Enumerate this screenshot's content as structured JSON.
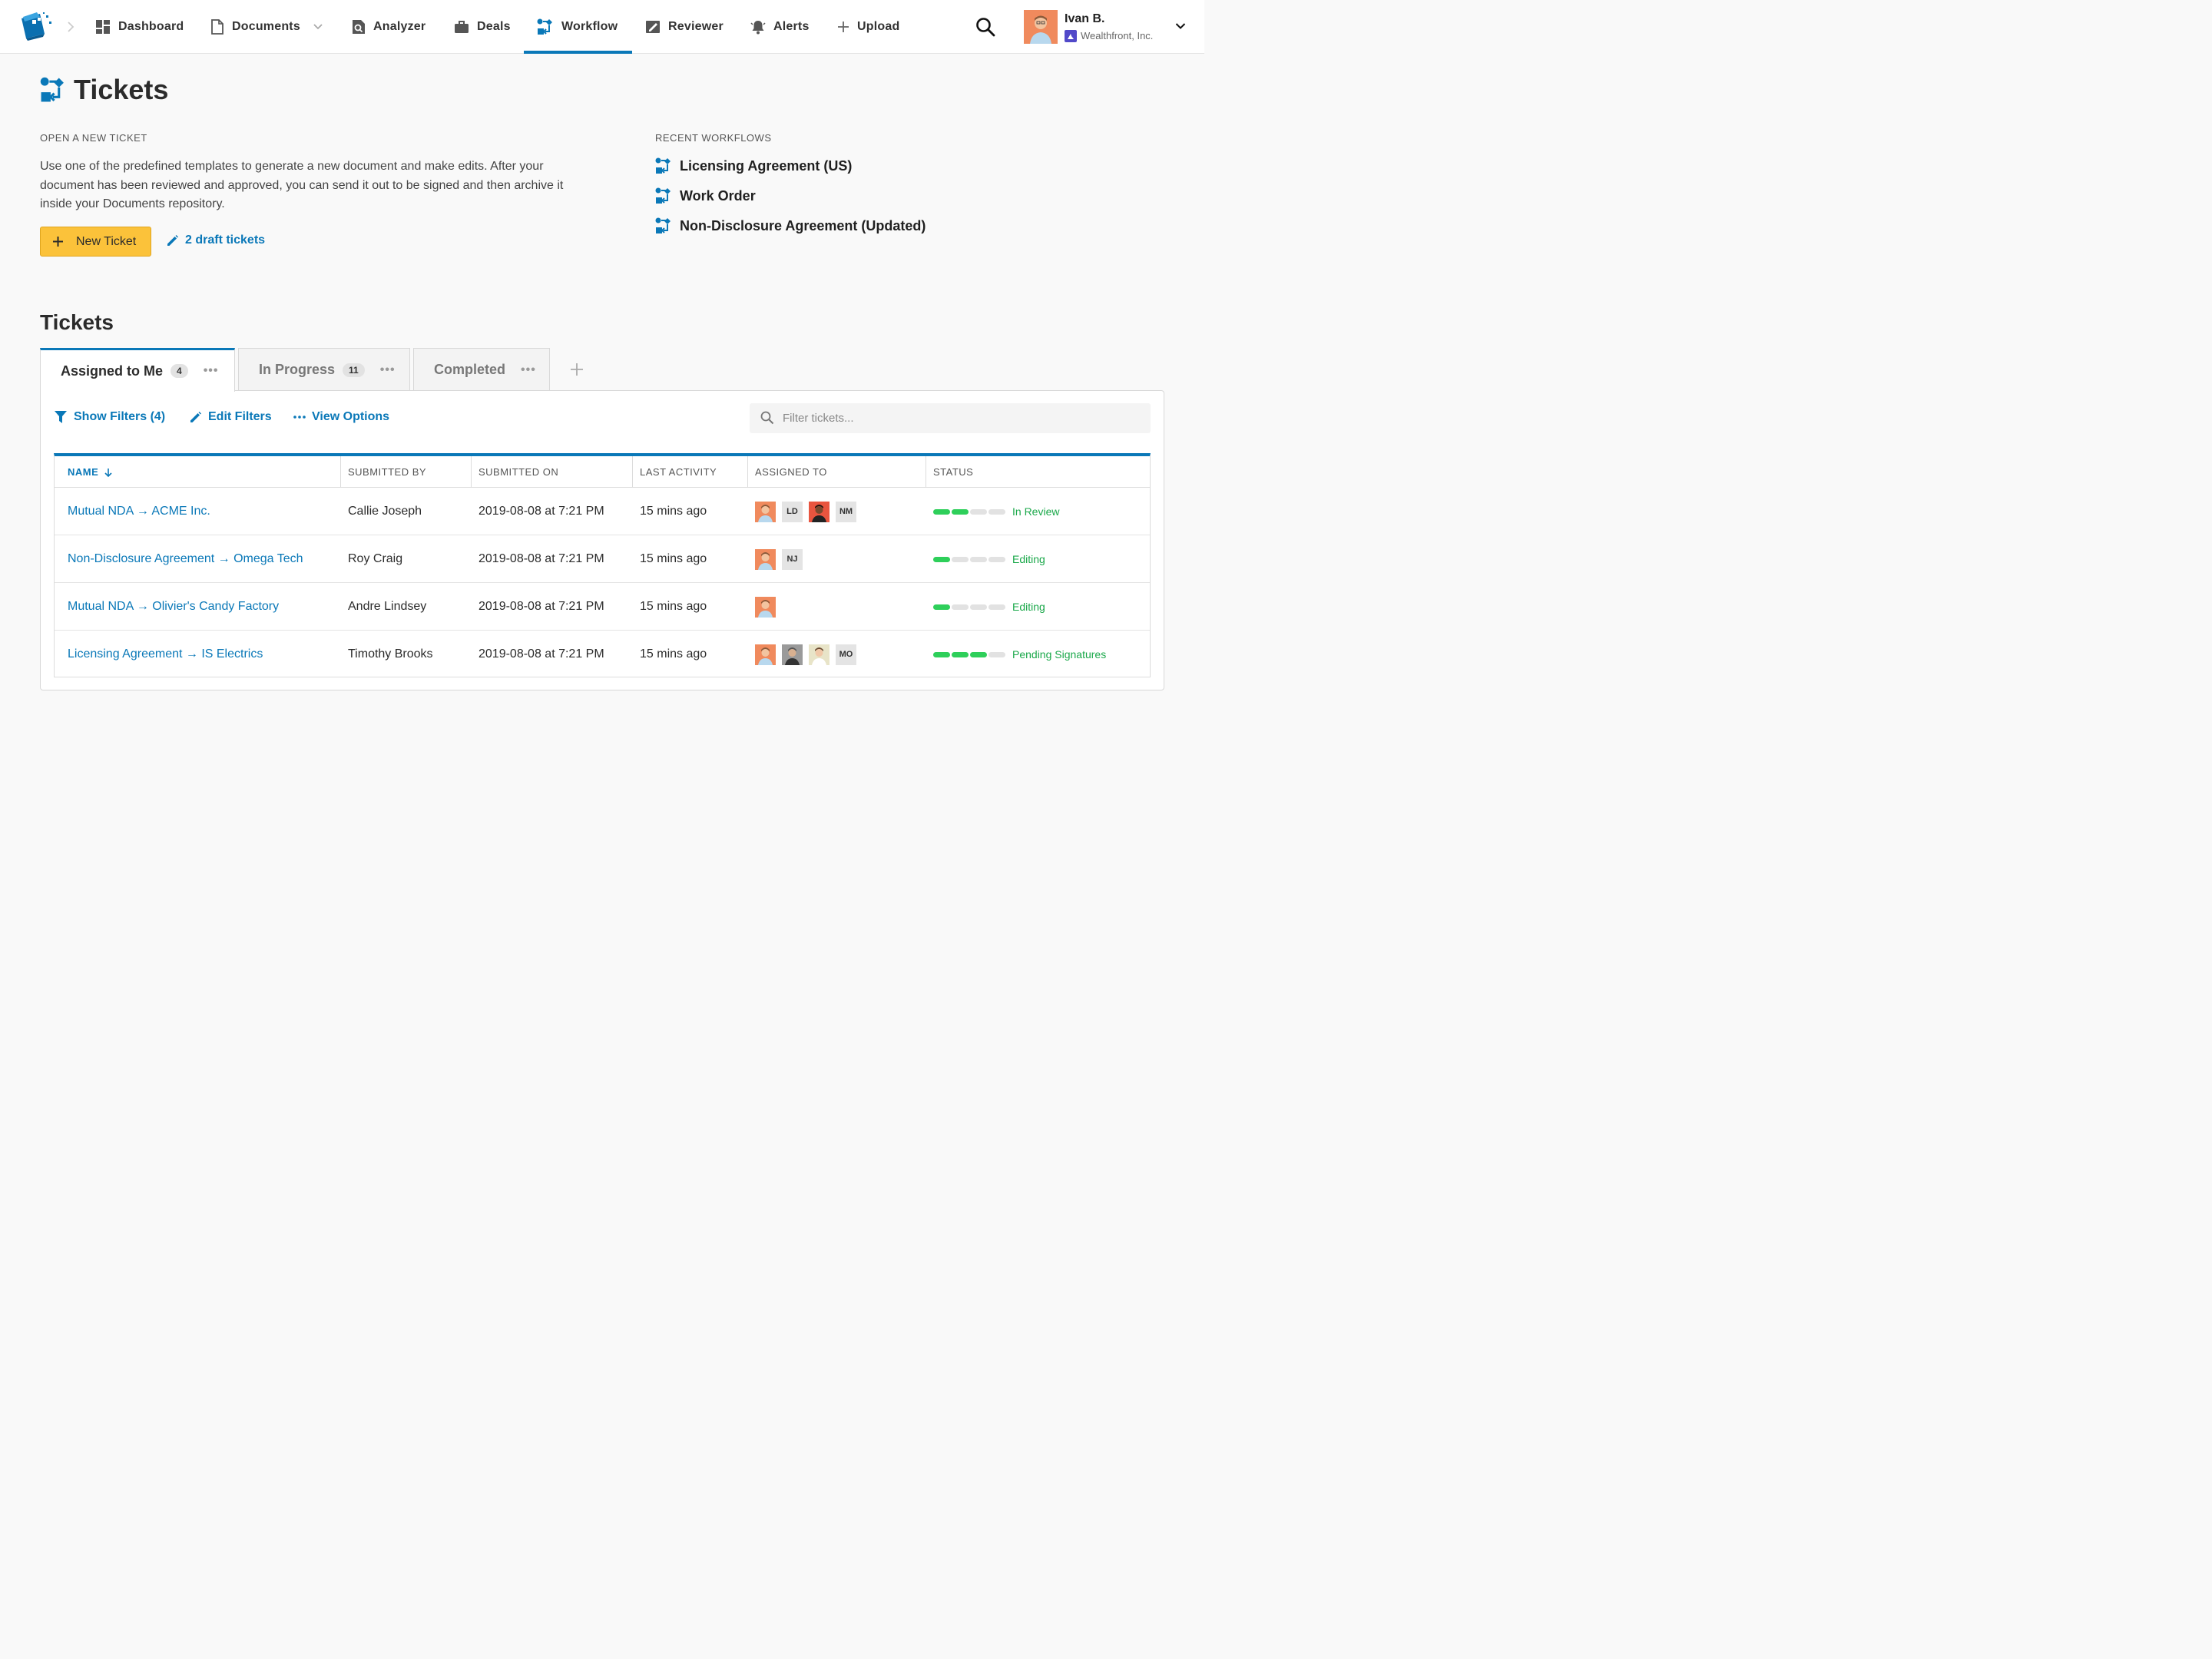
{
  "nav": {
    "items": [
      {
        "id": "dashboard",
        "label": "Dashboard",
        "icon": "dashboard-icon"
      },
      {
        "id": "documents",
        "label": "Documents",
        "icon": "document-icon"
      },
      {
        "id": "analyzer",
        "label": "Analyzer",
        "icon": "analyzer-icon"
      },
      {
        "id": "deals",
        "label": "Deals",
        "icon": "briefcase-icon"
      },
      {
        "id": "workflow",
        "label": "Workflow",
        "icon": "workflow-icon",
        "active": true
      },
      {
        "id": "reviewer",
        "label": "Reviewer",
        "icon": "reviewer-icon"
      },
      {
        "id": "alerts",
        "label": "Alerts",
        "icon": "bell-icon"
      },
      {
        "id": "upload",
        "label": "Upload",
        "icon": "plus-icon"
      }
    ]
  },
  "user": {
    "name": "Ivan B.",
    "org": "Wealthfront, Inc."
  },
  "page": {
    "title": "Tickets"
  },
  "open_ticket": {
    "label": "Open a new ticket",
    "description": "Use one of the predefined templates to generate a new document and make edits. After your document has been reviewed and approved, you can send it out to be signed and then archive it inside your Documents repository.",
    "new_button": "New Ticket",
    "drafts_link": "2 draft tickets"
  },
  "recent_workflows": {
    "label": "Recent workflows",
    "items": [
      "Licensing Agreement (US)",
      "Work Order",
      "Non-Disclosure Agreement (Updated)"
    ]
  },
  "tickets": {
    "heading": "Tickets",
    "tabs": [
      {
        "label": "Assigned to Me",
        "count": "4",
        "active": true
      },
      {
        "label": "In Progress",
        "count": "11"
      },
      {
        "label": "Completed",
        "count": ""
      }
    ],
    "toolbar": {
      "show_filters": "Show Filters (4)",
      "edit_filters": "Edit Filters",
      "view_options": "View Options",
      "filter_placeholder": "Filter tickets..."
    },
    "columns": [
      "Name",
      "Submitted By",
      "Submitted On",
      "Last Activity",
      "Assigned To",
      "Status"
    ],
    "rows": [
      {
        "name": "Mutual NDA → ACME Inc.",
        "submitted_by": "Callie Joseph",
        "submitted_on": "2019-08-08 at 7:21 PM",
        "last_activity": "15 mins ago",
        "assignees": [
          {
            "type": "photo",
            "tone": "orange"
          },
          {
            "type": "initials",
            "text": "LD"
          },
          {
            "type": "photo",
            "tone": "red"
          },
          {
            "type": "initials",
            "text": "NM"
          }
        ],
        "progress": 2,
        "status": "In Review"
      },
      {
        "name": "Non-Disclosure Agreement → Omega Tech",
        "submitted_by": "Roy Craig",
        "submitted_on": "2019-08-08 at 7:21 PM",
        "last_activity": "15 mins ago",
        "assignees": [
          {
            "type": "photo",
            "tone": "orange"
          },
          {
            "type": "initials",
            "text": "NJ"
          }
        ],
        "progress": 1,
        "status": "Editing"
      },
      {
        "name": "Mutual NDA → Olivier's Candy Factory",
        "submitted_by": "Andre Lindsey",
        "submitted_on": "2019-08-08 at 7:21 PM",
        "last_activity": "15 mins ago",
        "assignees": [
          {
            "type": "photo",
            "tone": "orange"
          }
        ],
        "progress": 1,
        "status": "Editing"
      },
      {
        "name": "Licensing Agreement → IS Electrics",
        "submitted_by": "Timothy Brooks",
        "submitted_on": "2019-08-08 at 7:21 PM",
        "last_activity": "15 mins ago",
        "assignees": [
          {
            "type": "photo",
            "tone": "orange"
          },
          {
            "type": "photo",
            "tone": "grey"
          },
          {
            "type": "photo",
            "tone": "cream"
          },
          {
            "type": "initials",
            "text": "MO"
          }
        ],
        "progress": 3,
        "status": "Pending Signatures"
      }
    ]
  },
  "colors": {
    "accent": "#0a78b8",
    "button": "#fbc23a",
    "status_green": "#2ecf5a",
    "status_text": "#1aa84a"
  }
}
